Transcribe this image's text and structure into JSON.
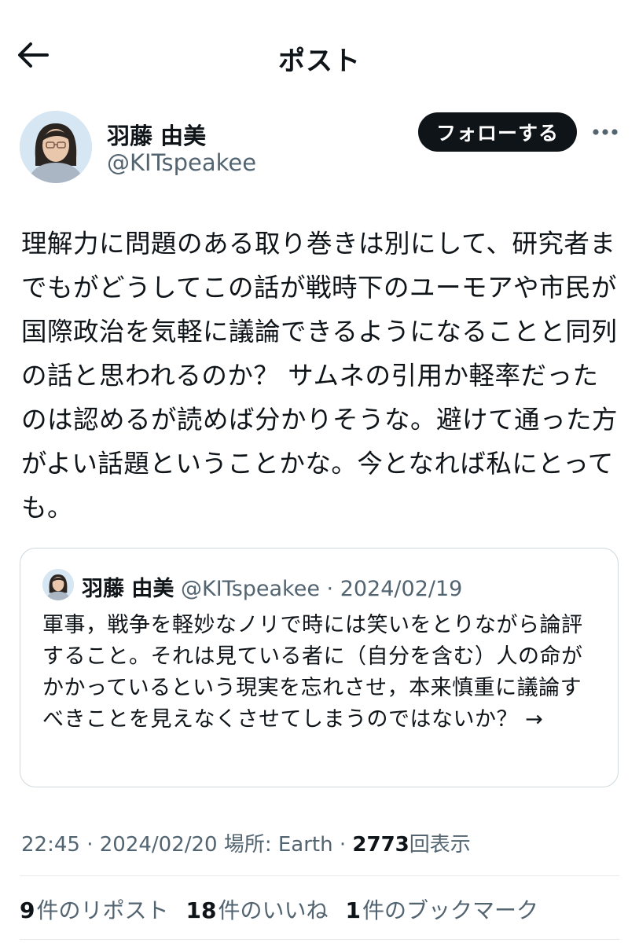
{
  "header": {
    "title": "ポスト"
  },
  "author": {
    "name": "羽藤 由美",
    "handle": "@KITspeakee",
    "follow_label": "フォローする"
  },
  "post": {
    "text": "理解力に問題のある取り巻きは別にして、研究者までもがどうしてこの話が戦時下のユーモアや市民が国際政治を気軽に議論できるようになることと同列の話と思われるのか？ サムネの引用か軽率だったのは認めるが読めば分かりそうな。避けて通った方がよい話題ということかな。今となれば私にとっても。"
  },
  "quote": {
    "name": "羽藤 由美",
    "handle": "@KITspeakee",
    "dot": " · ",
    "date": "2024/02/19",
    "text": "軍事，戦争を軽妙なノリで時には笑いをとりながら論評すること。それは見ている者に（自分を含む）人の命がかかっているという現実を忘れさせ，本来慎重に議論すべきことを見えなくさせてしまうのではないか？ →"
  },
  "meta": {
    "time": "22:45",
    "sep1": " · ",
    "date": "2024/02/20",
    "location": " 場所: Earth",
    "sep2": " · ",
    "views_count": "2773",
    "views_label": "回表示"
  },
  "stats": {
    "reposts_count": "9",
    "reposts_label": "件のリポスト",
    "likes_count": "18",
    "likes_label": "件のいいね",
    "bookmarks_count": "1",
    "bookmarks_label": "件のブックマーク"
  },
  "icons": {
    "back": "arrow-left-icon",
    "more": "more-horizontal-icon"
  }
}
